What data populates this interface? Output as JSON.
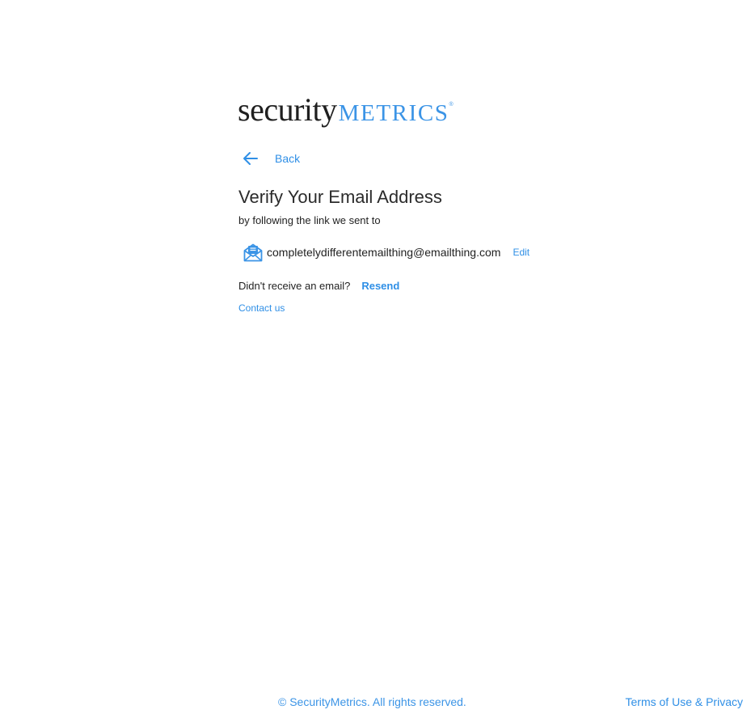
{
  "brand": {
    "logo_word_1": "security",
    "logo_word_2": "METRICS",
    "logo_registered": "®",
    "primary_color": "#3b94e6",
    "logo_dark_color": "#1f1f1f"
  },
  "nav": {
    "back_label": "Back",
    "back_icon": "arrow-left-icon"
  },
  "verify": {
    "title": "Verify Your Email Address",
    "subtitle": "by following the link we sent to",
    "email_icon": "open-envelope-icon",
    "email": "completelydifferentemailthing@emailthing.com",
    "edit_label": "Edit",
    "resend_prompt": "Didn't receive an email?",
    "resend_label": "Resend",
    "contact_label": "Contact us"
  },
  "footer": {
    "copyright": "© SecurityMetrics. All rights reserved.",
    "terms_label": "Terms of Use & Privacy"
  }
}
